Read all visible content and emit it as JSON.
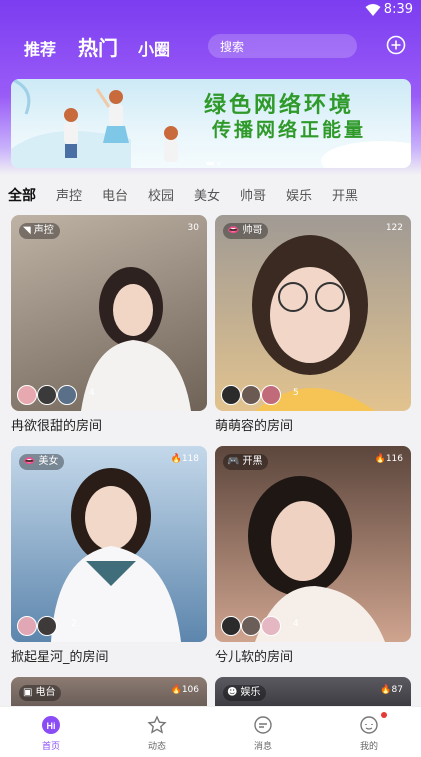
{
  "status_bar": {
    "time": "8:39"
  },
  "top_nav": {
    "tabs": [
      "推荐",
      "热门",
      "小圈"
    ],
    "active": "热门",
    "search_placeholder": "搜索"
  },
  "banner": {
    "line1": "绿色网络环境",
    "line2": "传播网络正能量"
  },
  "categories": [
    "全部",
    "声控",
    "电台",
    "校园",
    "美女",
    "帅哥",
    "娱乐",
    "开黑"
  ],
  "rooms": [
    {
      "tag": "声控",
      "heat": "30",
      "title": "冉欲很甜的房间",
      "member_count": "4",
      "color": "#8a7b70"
    },
    {
      "tag": "帅哥",
      "heat": "122",
      "title": "萌萌容的房间",
      "member_count": "5",
      "color": "#c9a57e"
    },
    {
      "tag": "美女",
      "heat": "118",
      "title": "掀起星河_的房间",
      "member_count": "2",
      "color": "#8fb1cf"
    },
    {
      "tag": "开黑",
      "heat": "116",
      "title": "兮儿软的房间",
      "member_count": "4",
      "color": "#8c6a5c"
    },
    {
      "tag": "电台",
      "heat": "106",
      "title": "",
      "member_count": "",
      "color": "#6b5e58"
    },
    {
      "tag": "娱乐",
      "heat": "87",
      "title": "",
      "member_count": "",
      "color": "#4d4d52"
    }
  ],
  "tab_bar": {
    "items": [
      "首页",
      "动态",
      "消息",
      "我的"
    ],
    "active": "首页"
  },
  "colors": {
    "brand": "#7b3df0",
    "badge": "#e53935"
  }
}
